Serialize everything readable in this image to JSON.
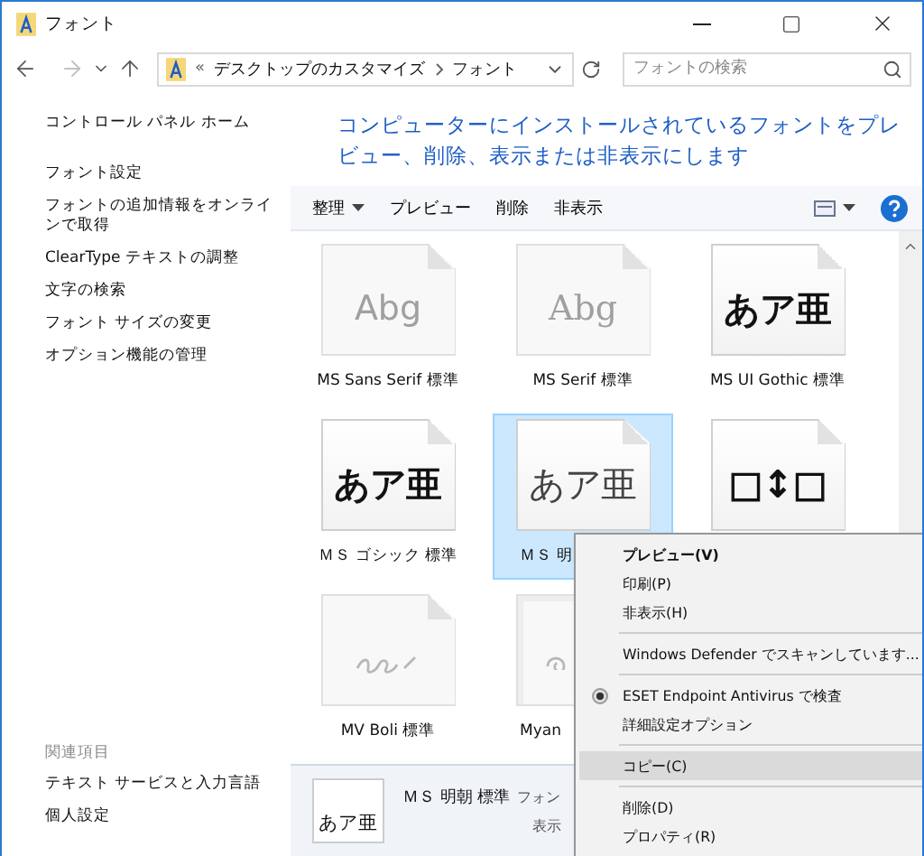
{
  "window": {
    "title": "フォント"
  },
  "address": {
    "overflow": "«",
    "path": [
      "デスクトップのカスタマイズ",
      "フォント"
    ]
  },
  "search": {
    "placeholder": "フォントの検索"
  },
  "nav": {
    "back_disabled": false,
    "forward_disabled": true
  },
  "sidebar": {
    "links": [
      "コントロール パネル ホーム",
      "フォント設定",
      "フォントの追加情報をオンラインで取得",
      "ClearType テキストの調整",
      "文字の検索",
      "フォント サイズの変更",
      "オプション機能の管理"
    ],
    "related_heading": "関連項目",
    "related": [
      "テキスト サービスと入力言語",
      "個人設定"
    ]
  },
  "header": "コンピューターにインストールされているフォントをプレビュー、削除、表示または非表示にします",
  "toolbar": {
    "organize": "整理",
    "buttons": [
      "プレビュー",
      "削除",
      "非表示"
    ]
  },
  "fonts": [
    {
      "kind": "latin",
      "sample": "Abg",
      "label": "MS Sans Serif 標準",
      "hidden": true,
      "selected": false,
      "serif": false
    },
    {
      "kind": "latin",
      "sample": "Abg",
      "label": "MS Serif 標準",
      "hidden": true,
      "selected": false,
      "serif": true
    },
    {
      "kind": "cjk",
      "sample": "あア亜",
      "label": "MS UI Gothic 標準",
      "hidden": false,
      "selected": false,
      "serif": false
    },
    {
      "kind": "cjk",
      "sample": "あア亜",
      "label": "ＭＳ ゴシック 標準",
      "hidden": false,
      "selected": false,
      "serif": false
    },
    {
      "kind": "cjk",
      "sample": "あア亜",
      "label": "ＭＳ 明",
      "hidden": false,
      "selected": true,
      "serif": true,
      "truncated": true
    },
    {
      "kind": "symbol",
      "sample": "□↕□",
      "hidden": false,
      "selected": false
    },
    {
      "kind": "script",
      "label": "MV Boli 標準",
      "hidden": true,
      "selected": false
    },
    {
      "kind": "family",
      "label": "Myan",
      "hidden": true,
      "selected": false,
      "truncated": true
    }
  ],
  "details": {
    "sample": "あア亜",
    "name": "ＭＳ 明朝 標準",
    "type": "フォン",
    "state": "表示"
  },
  "context_menu": [
    {
      "kind": "item",
      "label": "プレビュー(V)",
      "default": true,
      "highlighted": false
    },
    {
      "kind": "item",
      "label": "印刷(P)",
      "default": false,
      "highlighted": false
    },
    {
      "kind": "item",
      "label": "非表示(H)",
      "default": false,
      "highlighted": false
    },
    {
      "kind": "separator"
    },
    {
      "kind": "item",
      "label": "Windows Defender でスキャンしています...",
      "default": false,
      "highlighted": false
    },
    {
      "kind": "separator"
    },
    {
      "kind": "radio",
      "label": "ESET Endpoint Antivirus で検査",
      "default": false,
      "highlighted": false
    },
    {
      "kind": "item",
      "label": "詳細設定オプション",
      "default": false,
      "highlighted": false
    },
    {
      "kind": "separator"
    },
    {
      "kind": "item",
      "label": "コピー(C)",
      "default": false,
      "highlighted": true
    },
    {
      "kind": "separator"
    },
    {
      "kind": "item",
      "label": "削除(D)",
      "default": false,
      "highlighted": false
    },
    {
      "kind": "item",
      "label": "プロパティ(R)",
      "default": false,
      "highlighted": false
    }
  ]
}
